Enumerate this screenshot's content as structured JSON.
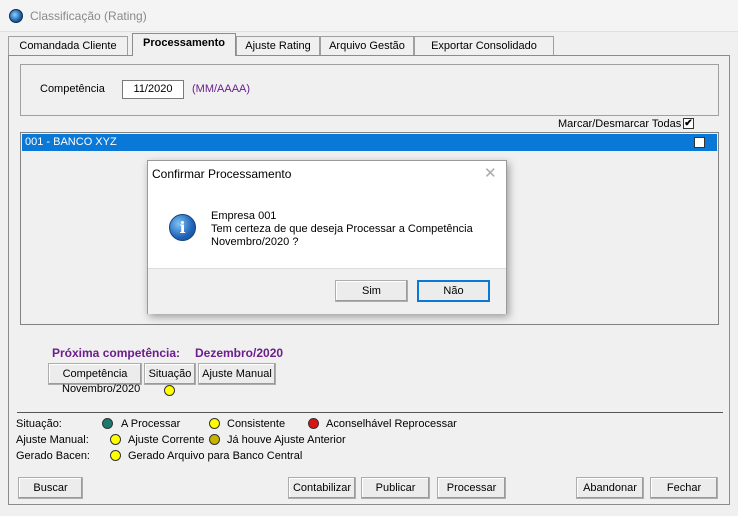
{
  "window": {
    "title": "Classificação (Rating)"
  },
  "tabs": [
    {
      "label": "Comandada Cliente"
    },
    {
      "label": "Processamento"
    },
    {
      "label": "Ajuste Rating"
    },
    {
      "label": "Arquivo Gestão"
    },
    {
      "label": "Exportar Consolidado"
    }
  ],
  "competencia": {
    "label": "Competência",
    "value": "11/2020",
    "format": "(MM/AAAA)"
  },
  "mark_all": {
    "label": "Marcar/Desmarcar Todas",
    "checked": "✔"
  },
  "list": {
    "rows": [
      {
        "label": "001 - BANCO XYZ",
        "checked": "✔"
      }
    ]
  },
  "next": {
    "label": "Próxima competência:",
    "value": "Dezembro/2020"
  },
  "subtable": {
    "headers": [
      "Competência",
      "Situação",
      "Ajuste Manual"
    ],
    "row": {
      "competencia": "Novembro/2020"
    }
  },
  "legend": {
    "situacao_label": "Situação:",
    "a_processar": "A Processar",
    "consistente": "Consistente",
    "reprocessar": "Aconselhável Reprocessar",
    "ajuste_label": "Ajuste Manual:",
    "ajuste_corrente": "Ajuste Corrente",
    "ja_houve": "Já houve Ajuste Anterior",
    "bacen_label": "Gerado Bacen:",
    "gerado": "Gerado Arquivo para Banco Central"
  },
  "buttons": {
    "buscar": "Buscar",
    "contabilizar": "Contabilizar",
    "publicar": "Publicar",
    "processar": "Processar",
    "abandonar": "Abandonar",
    "fechar": "Fechar"
  },
  "dialog": {
    "title": "Confirmar Processamento",
    "close": "✕",
    "icon": "i",
    "line1": "Empresa 001",
    "line2": "Tem certeza de que deseja Processar a Competência",
    "line3": "Novembro/2020 ?",
    "yes": "Sim",
    "no": "Não"
  },
  "colors": {
    "a_processar": "#1a7a6e",
    "consistente": "#ffff00",
    "reprocessar": "#e01010",
    "ja_houve": "#c8b400",
    "accent_purple": "#6b1e8c",
    "selection": "#0a78d7"
  },
  "icons": [
    "app-icon",
    "info-icon",
    "checkbox-icon",
    "close-icon"
  ]
}
